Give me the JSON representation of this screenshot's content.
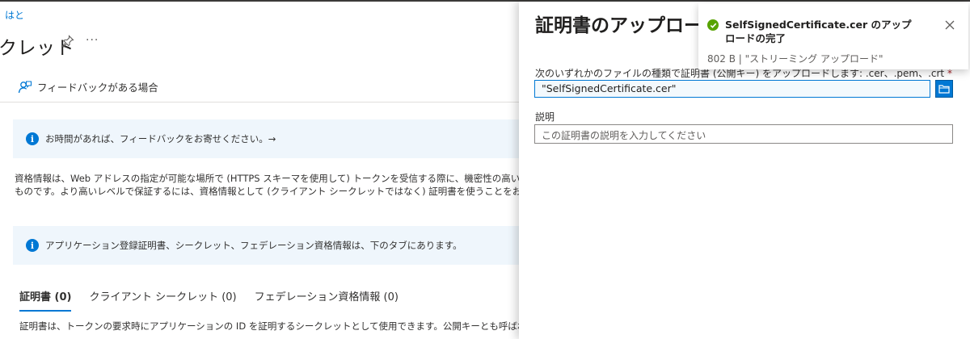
{
  "breadcrumb": "はと",
  "page_title": "クレット",
  "feedback_link": "フィードバックがある場合",
  "info_banner_1": "お時間があれば、フィードバックをお寄せください。→",
  "description": {
    "line1": "資格情報は、Web アドレスの指定が可能な場所で (HTTPS スキーマを使用して) トークンを受信する際に、機密性の高いアプリケー",
    "line2": "ものです。より高いレベルで保証するには、資格情報として (クライアント シークレットではなく) 証明書を使うことをお勧めします。"
  },
  "info_banner_2": "アプリケーション登録証明書、シークレット、フェデレーション資格情報は、下のタブにあります。",
  "tabs": [
    {
      "label": "証明書 (0)",
      "active": true
    },
    {
      "label": "クライアント シークレット (0)",
      "active": false
    },
    {
      "label": "フェデレーション資格情報 (0)",
      "active": false
    }
  ],
  "cert_tab_description": "証明書は、トークンの要求時にアプリケーションの ID を証明するシークレットとして使用できます。公開キーとも呼ばれます。",
  "panel": {
    "title": "証明書のアップロード",
    "file_label": "次のいずれかのファイルの種類で証明書 (公開キー) をアップロードします: .cer、.pem、.crt",
    "required_mark": "*",
    "file_value": "\"SelfSignedCertificate.cer\"",
    "description_label": "説明",
    "description_placeholder": "この証明書の説明を入力してください"
  },
  "toast": {
    "title": "SelfSignedCertificate.cer のアップロードの完了",
    "subtitle": "802 B | \"ストリーミング アップロード\""
  },
  "colors": {
    "accent": "#0078d4",
    "success": "#57a300",
    "info_background": "#eff6fc"
  },
  "icons": {
    "pin": "pin-icon",
    "more": "more-icon",
    "feedback": "feedback-person-icon",
    "info": "info-icon",
    "browse": "folder-icon",
    "success": "check-circle-icon",
    "close": "close-icon"
  }
}
